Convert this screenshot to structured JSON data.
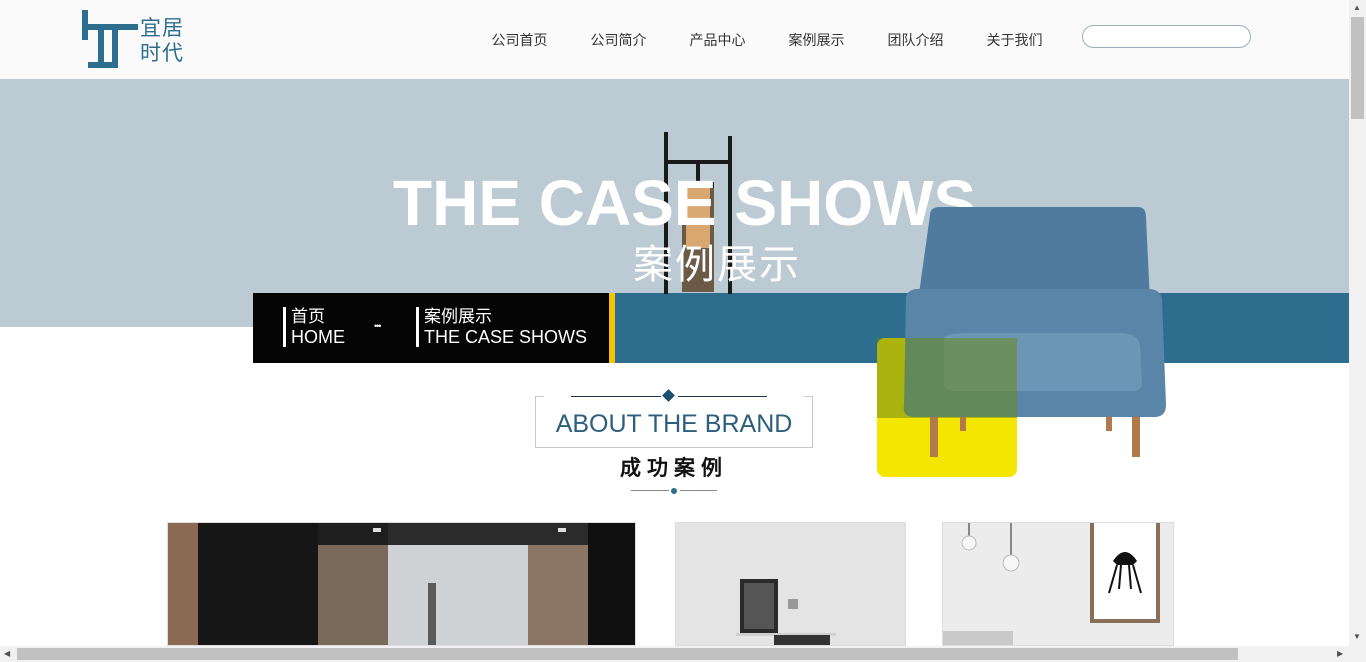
{
  "logo": {
    "line1": "宜居",
    "line2": "时代"
  },
  "nav": {
    "items": [
      "公司首页",
      "公司简介",
      "产品中心",
      "案例展示",
      "团队介绍",
      "关于我们"
    ]
  },
  "search": {
    "placeholder": ""
  },
  "hero": {
    "title": "THE CASE SHOWS",
    "subtitle": "案例展示"
  },
  "breadcrumb": {
    "home_cn": "首页",
    "home_en": "HOME",
    "separator": "•••",
    "current_cn": "案例展示",
    "current_en": "THE CASE SHOWS"
  },
  "brand": {
    "title": "ABOUT THE BRAND",
    "subtitle": "成功案例"
  },
  "colors": {
    "accent": "#2d6e8e",
    "hero_bg": "#bccad3",
    "yellow": "#f5e600",
    "dark": "#050505"
  },
  "icons": [
    "logo-mark-icon",
    "lamp-image",
    "armchair-image",
    "scroll-up-icon",
    "scroll-down-icon",
    "scroll-left-icon",
    "scroll-right-icon"
  ]
}
